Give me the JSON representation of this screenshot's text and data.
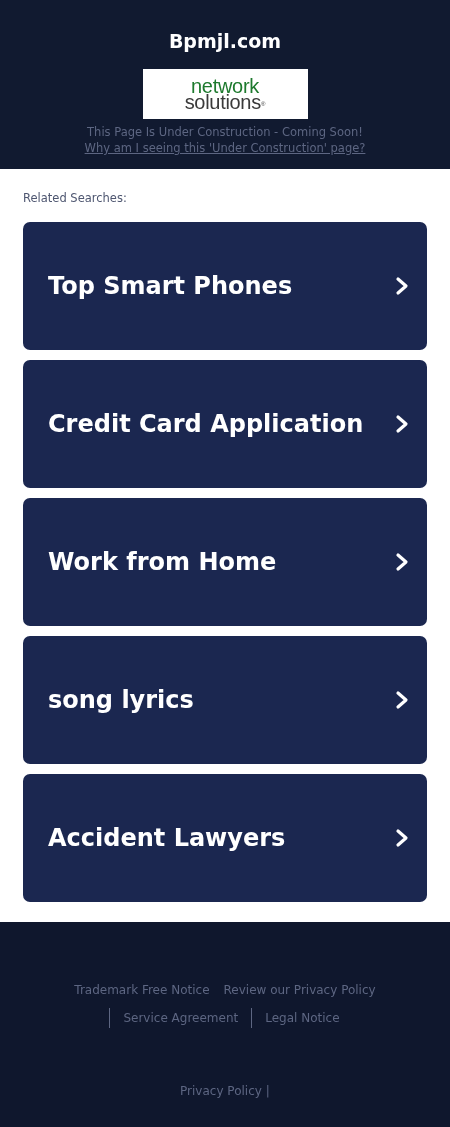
{
  "header": {
    "site_title": "Bpmjl.com",
    "logo": {
      "line_1": "network",
      "line_2": "solutions",
      "mark": "®"
    },
    "notice": "This Page Is Under Construction - Coming Soon!",
    "notice_link": "Why am I seeing this 'Under Construction' page?"
  },
  "related": {
    "heading": "Related Searches:",
    "items": [
      {
        "label": "Top Smart Phones"
      },
      {
        "label": "Credit Card Application"
      },
      {
        "label": "Work from Home"
      },
      {
        "label": "song lyrics"
      },
      {
        "label": "Accident Lawyers"
      }
    ]
  },
  "footer": {
    "links": [
      {
        "label": "Trademark Free Notice",
        "separator_before": false
      },
      {
        "label": "Review our Privacy Policy",
        "separator_before": false
      },
      {
        "label": "Service Agreement",
        "separator_before": true
      },
      {
        "label": "Legal Notice",
        "separator_before": true
      }
    ],
    "bottom_link": "Privacy Policy",
    "bottom_separator": "|"
  }
}
